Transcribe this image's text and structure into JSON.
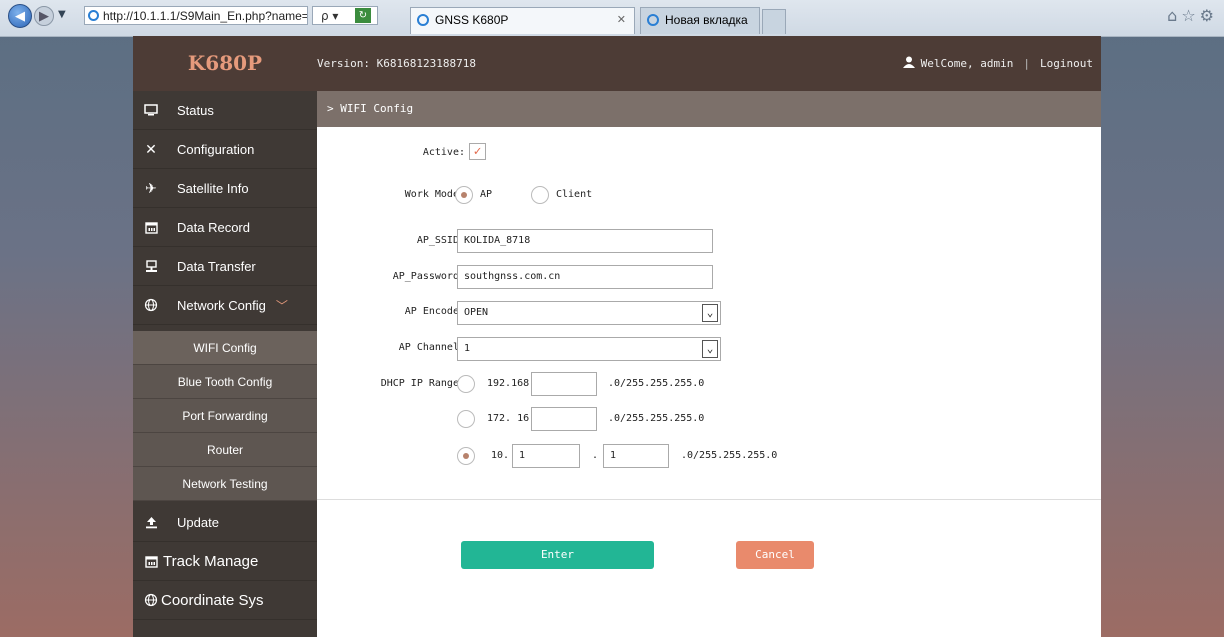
{
  "browser": {
    "url": "http://10.1.1.1/S9Main_En.php?name=admin",
    "search_glyph": "ρ ▾",
    "tabs": [
      {
        "label": "GNSS K680P",
        "active": true
      },
      {
        "label": "Новая вкладка",
        "active": false
      }
    ]
  },
  "header": {
    "logo": "K680P",
    "version": "Version: K68168123188718",
    "welcome": "WelCome, admin",
    "logout": "Loginout"
  },
  "sidebar": {
    "items": [
      {
        "label": "Status",
        "icon": "monitor-icon"
      },
      {
        "label": "Configuration",
        "icon": "tools-icon"
      },
      {
        "label": "Satellite Info",
        "icon": "satellite-icon"
      },
      {
        "label": "Data Record",
        "icon": "calendar-icon"
      },
      {
        "label": "Data Transfer",
        "icon": "transfer-icon"
      },
      {
        "label": "Network Config",
        "icon": "globe-icon"
      }
    ],
    "sub_items": [
      {
        "label": "WIFI Config",
        "active": true
      },
      {
        "label": "Blue Tooth Config"
      },
      {
        "label": "Port Forwarding"
      },
      {
        "label": "Router"
      },
      {
        "label": "Network Testing"
      }
    ],
    "bottom_items": [
      {
        "label": "Update",
        "icon": "upload-icon"
      },
      {
        "label": "Track Manage",
        "icon": "calendar-icon"
      },
      {
        "label": "Coordinate Sys",
        "icon": "globe-icon"
      }
    ]
  },
  "breadcrumb": "> WIFI Config",
  "form": {
    "active_label": "Active:",
    "active_checked": true,
    "work_mode_label": "Work Mode:",
    "work_mode_options": [
      "AP",
      "Client"
    ],
    "work_mode_selected": "AP",
    "ssid_label": "AP_SSID:",
    "ssid_value": "KOLIDA_8718",
    "password_label": "AP_Password:",
    "password_value": "southgnss.com.cn",
    "encode_label": "AP Encode:",
    "encode_value": "OPEN",
    "channel_label": "AP Channel:",
    "channel_value": "1",
    "dhcp_label": "DHCP IP Range:",
    "dhcp_options": [
      {
        "prefix": "192.168.",
        "suffix": ".0/255.255.255.0",
        "value": "",
        "selected": false
      },
      {
        "prefix": "172. 16.",
        "suffix": ".0/255.255.255.0",
        "value": "",
        "selected": false
      },
      {
        "prefix": "10.",
        "value1": "1",
        "dot": ".",
        "value2": "1",
        "suffix": ".0/255.255.255.0",
        "selected": true
      }
    ],
    "enter_label": "Enter",
    "cancel_label": "Cancel"
  },
  "colors": {
    "header_bg": "#4d3c36",
    "sidebar_bg": "#3f3935",
    "accent_logo": "#e59a7c",
    "enter_btn": "#22b695",
    "cancel_btn": "#e98a6c"
  }
}
